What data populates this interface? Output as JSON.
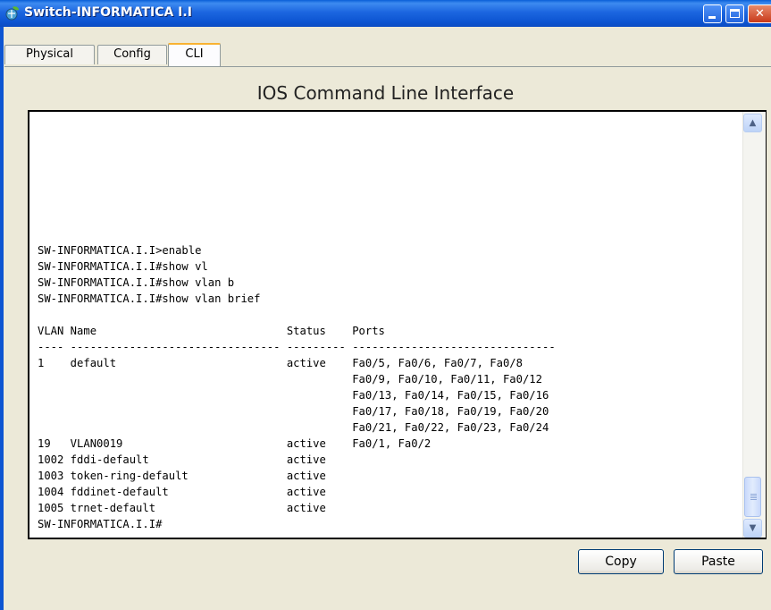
{
  "window": {
    "title": "Switch-INFORMATICA I.I",
    "controls": {
      "minimize": "",
      "maximize": "",
      "close": "✕"
    }
  },
  "tabs": [
    {
      "label": "Physical",
      "active": false
    },
    {
      "label": "Config",
      "active": false
    },
    {
      "label": "CLI",
      "active": true
    }
  ],
  "cli": {
    "heading": "IOS Command Line Interface",
    "terminal_text": "SW-INFORMATICA.I.I>enable\nSW-INFORMATICA.I.I#show vl\nSW-INFORMATICA.I.I#show vlan b\nSW-INFORMATICA.I.I#show vlan brief\n\nVLAN Name                             Status    Ports\n---- -------------------------------- --------- -------------------------------\n1    default                          active    Fa0/5, Fa0/6, Fa0/7, Fa0/8\n                                                Fa0/9, Fa0/10, Fa0/11, Fa0/12\n                                                Fa0/13, Fa0/14, Fa0/15, Fa0/16\n                                                Fa0/17, Fa0/18, Fa0/19, Fa0/20\n                                                Fa0/21, Fa0/22, Fa0/23, Fa0/24\n19   VLAN0019                         active    Fa0/1, Fa0/2\n1002 fddi-default                     active\n1003 token-ring-default               active\n1004 fddinet-default                  active\n1005 trnet-default                    active\nSW-INFORMATICA.I.I#",
    "scroll_up": "▲",
    "scroll_down": "▼"
  },
  "buttons": {
    "copy": "Copy",
    "paste": "Paste"
  },
  "colors": {
    "titlebar": "#0d55d2",
    "window_bg": "#ece9d8",
    "active_tab_accent": "#f8b232",
    "terminal_bg": "#ffffff"
  },
  "icons": {
    "app": "packet-tracer-icon"
  }
}
